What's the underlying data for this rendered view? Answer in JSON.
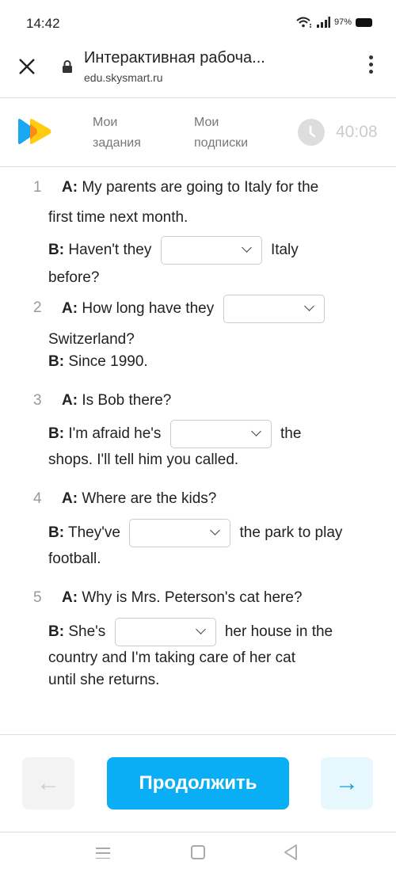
{
  "status_bar": {
    "time": "14:42",
    "battery": "97%",
    "icons": [
      "wifi-icon",
      "signal-icon",
      "battery-icon"
    ]
  },
  "browser": {
    "title": "Интерактивная рабоча...",
    "url": "edu.skysmart.ru",
    "close_icon": "close-icon",
    "menu_icon": "more-vert-icon"
  },
  "header": {
    "nav": [
      {
        "line1": "Мои",
        "line2": "задания"
      },
      {
        "line1": "Мои",
        "line2": "подписки"
      }
    ],
    "timer": "40:08"
  },
  "tasks": [
    {
      "num": "1",
      "lines": [
        {
          "label": "A:",
          "before": "My parents are going to Italy for the"
        },
        {
          "text": "first time next month."
        },
        {
          "label": "B:",
          "before": "Haven't they",
          "dropdown": "",
          "after": "Italy"
        },
        {
          "text": "before?"
        }
      ]
    },
    {
      "num": "2",
      "lines": [
        {
          "label": "A:",
          "before": "How long have they",
          "dropdown": ""
        },
        {
          "text": "Switzerland?"
        },
        {
          "label": "B:",
          "before": "Since 1990."
        }
      ]
    },
    {
      "num": "3",
      "lines": [
        {
          "label": "A:",
          "before": "Is Bob there?"
        },
        {
          "label": "B:",
          "before": "I'm afraid he's",
          "dropdown": "",
          "after": "the"
        },
        {
          "text": "shops. I'll tell him you called."
        }
      ]
    },
    {
      "num": "4",
      "lines": [
        {
          "label": "A:",
          "before": "Where are the kids?"
        },
        {
          "label": "B:",
          "before": "They've",
          "dropdown": "",
          "after": "the park to play"
        },
        {
          "text": "football."
        }
      ]
    },
    {
      "num": "5",
      "lines": [
        {
          "label": "A:",
          "before": "Why is Mrs. Peterson's cat here?"
        },
        {
          "label": "B:",
          "before": "She's",
          "dropdown": "",
          "after": "her house in the"
        },
        {
          "text": "country and I'm taking care of her cat"
        },
        {
          "text": "until she returns."
        }
      ]
    }
  ],
  "footer": {
    "prev": "←",
    "continue": "Продолжить",
    "next": "→"
  },
  "colors": {
    "accent": "#0aaef4",
    "next_bg": "#e6f8fe",
    "prev_bg": "#f3f3f3"
  }
}
